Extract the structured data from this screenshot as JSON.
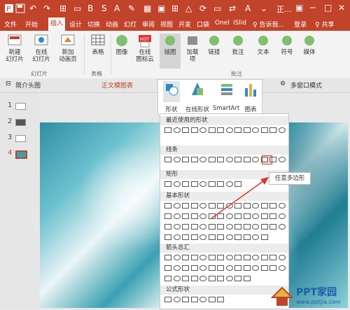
{
  "titlebar": {
    "title": "正...",
    "quick_access": [
      "save-icon",
      "undo-icon",
      "redo-icon"
    ]
  },
  "tabs": [
    "文件",
    "开始",
    "插入",
    "设计",
    "切换",
    "动画",
    "幻灯",
    "审阅",
    "视图",
    "开发",
    "口袋",
    "Onel",
    "iSlid",
    "♀ 告诉我...",
    "登录",
    "♀ 共享"
  ],
  "active_tab_index": 2,
  "ribbon": {
    "groups": [
      {
        "label": "幻灯片",
        "items": [
          "新建\n幻灯片",
          "在线\n幻灯片",
          "新加\n动画页"
        ]
      },
      {
        "label": "表格",
        "items": [
          "表格"
        ]
      },
      {
        "label": "",
        "items": [
          "图像",
          "在线\n图标云",
          "插图",
          "加载\n项",
          "链接",
          "批注",
          "文本",
          "符号",
          "媒体"
        ]
      }
    ],
    "group_labels": [
      "幻灯片",
      "表格",
      "批注"
    ]
  },
  "doc_tabs": [
    "简介头图",
    "正文模图表",
    "多窗口模式"
  ],
  "slides": [
    {
      "num": "1"
    },
    {
      "num": "2"
    },
    {
      "num": "3"
    },
    {
      "num": "4",
      "selected": true
    }
  ],
  "insert_panel": {
    "items": [
      "形状",
      "在线形状",
      "SmartArt",
      "图表"
    ]
  },
  "shapes_panel": {
    "categories": [
      "最近使用的形状",
      "线条",
      "矩形",
      "基本形状",
      "箭头总汇",
      "公式形状"
    ]
  },
  "tooltip": "任意多边形",
  "watermark": {
    "brand": "PPT家园",
    "url": "www.pptjia.com"
  },
  "colors": {
    "accent": "#c0432a",
    "arrow": "#e0332e"
  }
}
